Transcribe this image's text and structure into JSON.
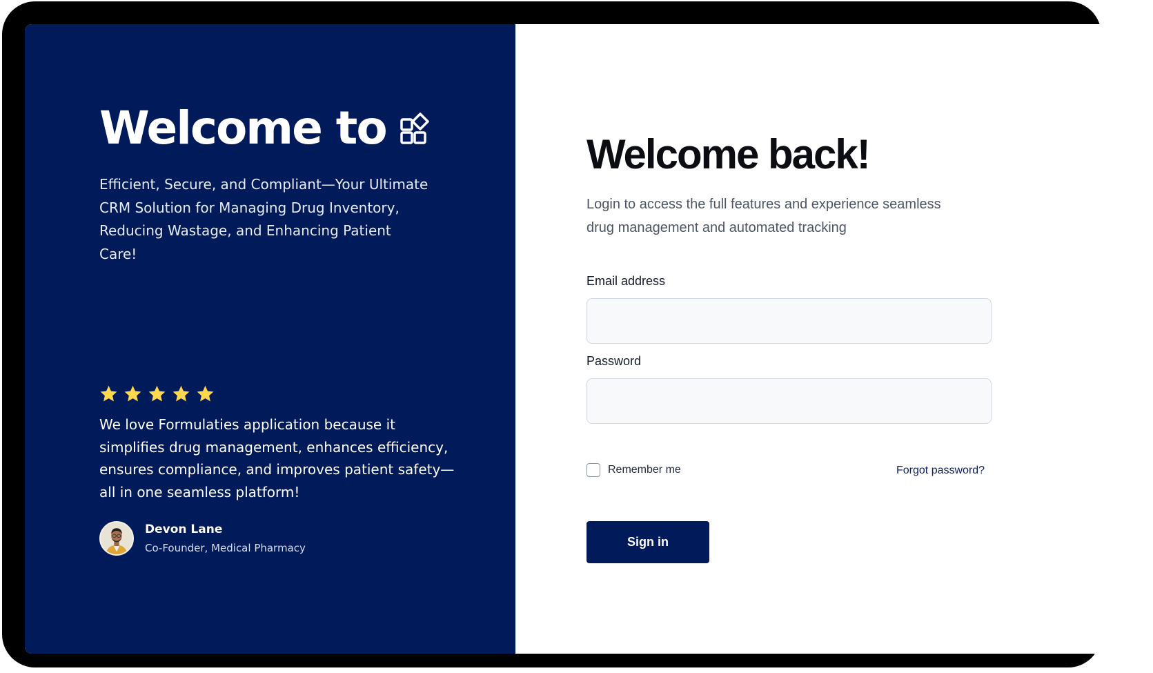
{
  "hero": {
    "title": "Welcome to",
    "subtitle": "Efficient, Secure, and Compliant—Your Ultimate CRM Solution for Managing Drug Inventory, Reducing Wastage, and Enhancing Patient Care!",
    "brand_icon": "blocks-icon"
  },
  "testimonial": {
    "rating": 5,
    "rating_max": 5,
    "star_color": "#FFD84D",
    "quote": "We love Formulaties application because it simplifies drug management, enhances efficiency, ensures compliance, and improves patient safety—all in one seamless platform!",
    "author_name": "Devon Lane",
    "author_role": "Co-Founder, Medical Pharmacy"
  },
  "login": {
    "title": "Welcome back!",
    "subtitle": "Login to access the full features and experience seamless drug management and automated tracking",
    "email_label": "Email address",
    "email_value": "",
    "password_label": "Password",
    "password_value": "",
    "remember_label": "Remember me",
    "remember_checked": false,
    "forgot_label": "Forgot password?",
    "submit_label": "Sign in"
  },
  "colors": {
    "brand_navy": "#001A5A",
    "input_bg": "#F7F9FB",
    "input_border": "#CFD8E3",
    "device_frame": "#000000"
  }
}
